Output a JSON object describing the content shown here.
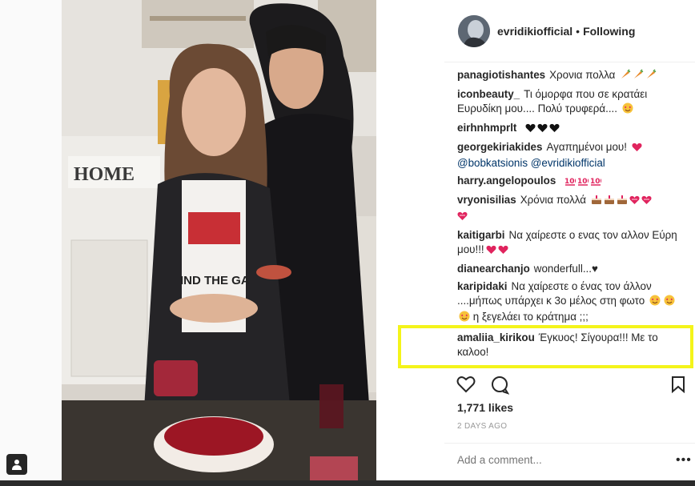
{
  "header": {
    "username": "evridikiofficial",
    "separator": "•",
    "follow_status": "Following"
  },
  "comments": [
    {
      "user": "panagiotishantes",
      "text": "Χρονια πολλα",
      "emoji": [
        "carrot-icon",
        "carrot-icon",
        "carrot-icon"
      ]
    },
    {
      "user": "iconbeauty_",
      "text": "Τι όμορφα που σε κρατάει Ευρυδίκη μου.... Πολύ τρυφερά....",
      "emoji": [
        "heart-eyes-icon"
      ]
    },
    {
      "user": "eirhnhmprlt",
      "text": "",
      "emoji": [
        "black-heart-icon",
        "black-heart-icon",
        "black-heart-icon"
      ]
    },
    {
      "user": "georgekiriakides",
      "text": "Αγαπημένοι μου!",
      "emoji": [
        "red-heart-icon"
      ],
      "mentions": [
        "@bobkatsionis",
        "@evridikiofficial"
      ]
    },
    {
      "user": "harry.angelopoulos",
      "text": "",
      "emoji": [
        "hundred-icon",
        "hundred-icon",
        "hundred-icon"
      ]
    },
    {
      "user": "vryonisilias",
      "text": "Χρόνια πολλά",
      "emoji": [
        "cake-icon",
        "cake-icon",
        "cake-icon",
        "heart-box-icon",
        "heart-box-icon",
        "heart-box-icon"
      ]
    },
    {
      "user": "kaitigarbi",
      "text": "Να χαίρεστε ο ενας τον αλλον Εύρη μου!!!",
      "emoji": [
        "red-heart-icon",
        "red-heart-icon"
      ]
    },
    {
      "user": "dianearchanjo",
      "text": "wonderfull...♥",
      "emoji": []
    },
    {
      "user": "karipidaki",
      "text": "Να χαίρεστε ο ένας τον άλλον ....μήπως υπάρχει κ 3ο μέλος στη φωτο",
      "emoji": [
        "heart-eyes-icon",
        "heart-eyes-icon"
      ],
      "suffix": "η ξεγελάει το κράτημα ;;;"
    },
    {
      "user": "amaliia_kirikou",
      "text": "Έγκυος! Σίγουρα!!! Με το καλοο!",
      "emoji": []
    }
  ],
  "likes": "1,771 likes",
  "time_ago": "2 DAYS AGO",
  "add_comment_placeholder": "Add a comment...",
  "more_label": "•••",
  "photo": {
    "sign_text": "HOME",
    "shirt_text": "IND THE GA"
  },
  "colors": {
    "highlight": "#f4f41a",
    "mention": "#003569",
    "muted": "#999999"
  }
}
